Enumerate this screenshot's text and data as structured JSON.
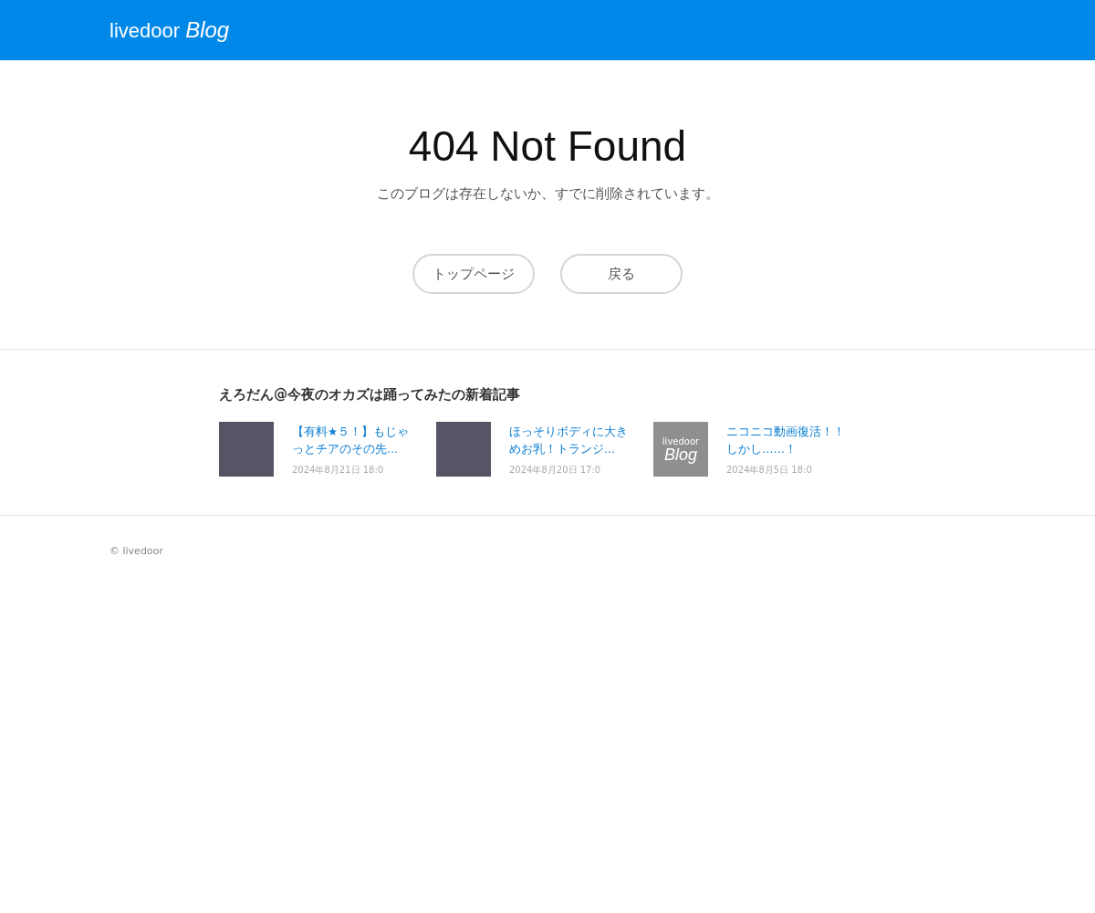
{
  "header": {
    "logo_text": "livedoor",
    "logo_emphasis": "Blog"
  },
  "error": {
    "title": "404 Not Found",
    "message": "このブログは存在しないか、すでに削除されています。"
  },
  "buttons": [
    "トップページ",
    "戻る"
  ],
  "recent": {
    "heading": "えろだん@今夜のオカズは踊ってみたの新着記事",
    "articles": [
      {
        "thumb": {
          "kind": "photo"
        },
        "title": "【有料★５！】もじゃっとチアのその先...",
        "date": "2024年8月21日 18:0"
      },
      {
        "thumb": {
          "kind": "photo"
        },
        "title": "ほっそりボディに大きめお乳！トランジ...",
        "date": "2024年8月20日 17:0"
      },
      {
        "thumb": {
          "kind": "logo",
          "small": "livedoor",
          "big": "Blog"
        },
        "title": "ニコニコ動画復活！！しかし……！",
        "date": "2024年8月5日 18:0"
      }
    ]
  },
  "footer": {
    "copyright": "© livedoor"
  }
}
